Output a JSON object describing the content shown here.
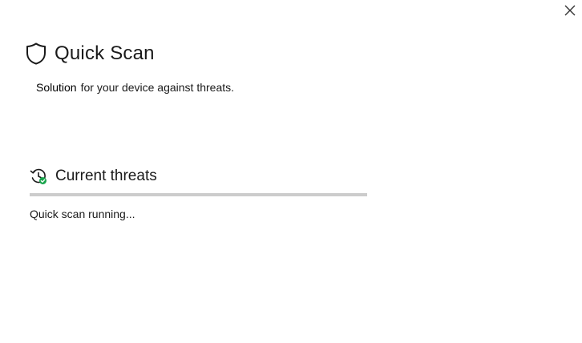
{
  "window": {
    "close_icon": "close-icon"
  },
  "header": {
    "icon": "shield-icon",
    "title": "Quick Scan"
  },
  "subtitle": {
    "strong": "Solution",
    "rest": "for your device against threats."
  },
  "threats": {
    "icon": "scan-history-icon",
    "title": "Current threats",
    "progress_fraction": 1.0,
    "status": "Quick scan running..."
  },
  "colors": {
    "progress_track": "#cccccc",
    "check_green": "#16a34a"
  }
}
